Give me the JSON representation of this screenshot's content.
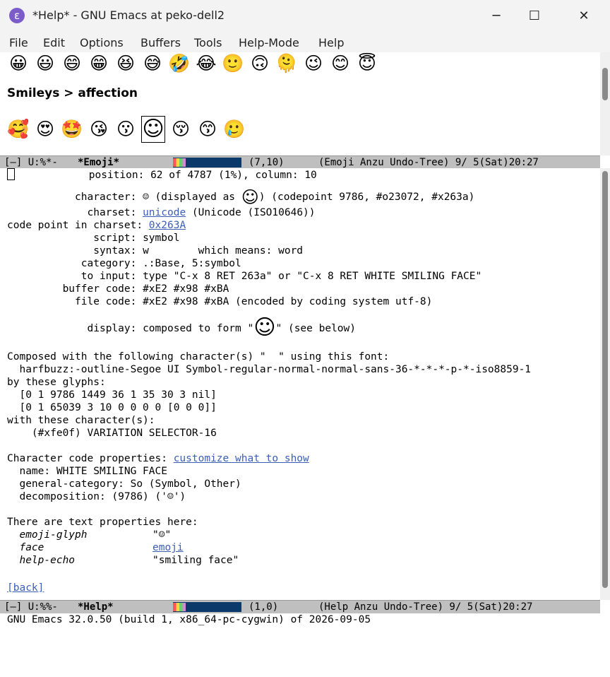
{
  "window": {
    "title": "*Help* - GNU Emacs at peko-dell2",
    "minimize": "─",
    "maximize": "☐",
    "close": "✕"
  },
  "menu": [
    "File",
    "Edit",
    "Options",
    "Buffers",
    "Tools",
    "Help-Mode",
    "Help"
  ],
  "emoji_buffer": {
    "row1": [
      "😀",
      "😃",
      "😄",
      "😁",
      "😆",
      "😅",
      "🤣",
      "😂",
      "🙂",
      "🙃",
      "🫠",
      "😉",
      "😊",
      "😇"
    ],
    "heading": "Smileys > affection",
    "row2": [
      "🥰",
      "😍",
      "🤩",
      "😘",
      "😗",
      "☺",
      "😚",
      "😙",
      "🥲"
    ]
  },
  "modeline_emoji": {
    "state": "[—] U:%*-",
    "buffer": "*Emoji*",
    "position": "(7,10)",
    "modes": "(Emoji Anzu Undo-Tree) 9/ 5(Sat)20:27"
  },
  "help": {
    "position_label": "position:",
    "position_value": "62 of 4787 (1%), column: 10",
    "character_label": "character:",
    "character_value_a": "☺ (displayed as ",
    "character_glyph": "☺",
    "character_value_b": ") (codepoint 9786, #o23072, #x263a)",
    "charset_label": "charset:",
    "charset_link": "unicode",
    "charset_rest": " (Unicode (ISO10646))",
    "codepoint_label": "code point in charset:",
    "codepoint_value": "0x263A",
    "script_label": "script:",
    "script_value": "symbol",
    "syntax_label": "syntax:",
    "syntax_value": "w        which means: word",
    "category_label": "category:",
    "category_value": ".:Base, 5:symbol",
    "input_label": "to input:",
    "input_value": "type \"C-x 8 RET 263a\" or \"C-x 8 RET WHITE SMILING FACE\"",
    "buffercode_label": "buffer code:",
    "buffercode_value": "#xE2 #x98 #xBA",
    "filecode_label": "file code:",
    "filecode_value": "#xE2 #x98 #xBA (encoded by coding system utf-8)",
    "display_label": "display:",
    "display_value_a": "composed to form \"",
    "display_glyph": "☺",
    "display_value_b": "\" (see below)",
    "composed_line": "Composed with the following character(s) \"  \" using this font:",
    "font_line": "  harfbuzz:-outline-Segoe UI Symbol-regular-normal-normal-sans-36-*-*-*-p-*-iso8859-1",
    "glyphs_line": "by these glyphs:",
    "glyph1": "  [0 1 9786 1449 36 1 35 30 3 nil]",
    "glyph2": "  [0 1 65039 3 10 0 0 0 0 [0 0 0]]",
    "with_line": "with these character(s):",
    "selector_line": "    (#xfe0f) VARIATION SELECTOR-16",
    "props_label": "Character code properties: ",
    "props_link": "customize what to show",
    "name_line": "  name: WHITE SMILING FACE",
    "gencat_line": "  general-category: So (Symbol, Other)",
    "decomp_line": "  decomposition: (9786) ('☺')",
    "textprops_line": "There are text properties here:",
    "tp1_key": "emoji-glyph",
    "tp1_val": "\"☺\"",
    "tp2_key": "face",
    "tp2_val": "emoji",
    "tp3_key": "help-echo",
    "tp3_val": "\"smiling face\"",
    "back": "[back]"
  },
  "modeline_help": {
    "state": "[—] U:%%-",
    "buffer": "*Help*",
    "position": "(1,0)",
    "modes": "(Help Anzu Undo-Tree) 9/ 5(Sat)20:27"
  },
  "echo": "GNU Emacs 32.0.50 (build 1, x86_64-pc-cygwin) of 2026-09-05"
}
